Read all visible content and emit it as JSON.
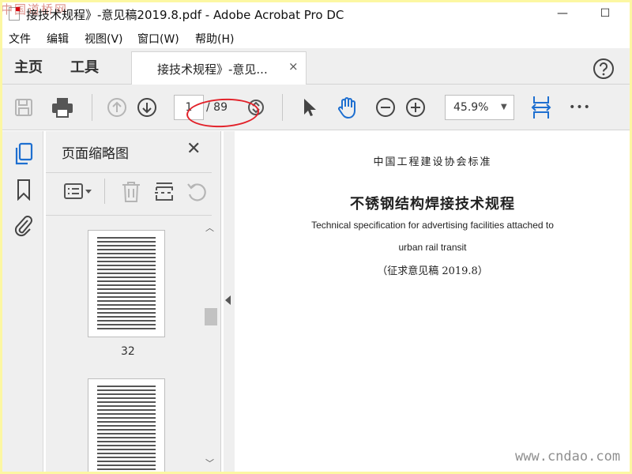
{
  "window": {
    "title": "接技术规程》-意见稿2019.8.pdf - Adobe Acrobat Pro DC",
    "watermark_top": "中国道桥网",
    "minimize": "—",
    "maximize": "☐"
  },
  "menu": [
    "文件",
    "编辑",
    "视图(V)",
    "窗口(W)",
    "帮助(H)"
  ],
  "tabs": {
    "home": "主页",
    "tools": "工具",
    "document": "接技术规程》-意见...",
    "close": "×"
  },
  "toolbar": {
    "page_current": "1",
    "page_total": "/ 89",
    "zoom": "45.9%",
    "more": "•••"
  },
  "thumbnails": {
    "title": "页面缩略图",
    "close": "✕",
    "visible_page_number": "32"
  },
  "document": {
    "org": "中国工程建设协会标准",
    "title": "不锈钢结构焊接技术规程",
    "english_line1": "Technical specification for advertising facilities attached to",
    "english_line2": "urban rail transit",
    "subtitle": "（征求意见稿 2019.8）"
  },
  "watermark": "www.cndao.com",
  "colors": {
    "accent_blue": "#1e6fd0",
    "annotation_red": "#e2222a",
    "toolbar_bg": "#efefef",
    "frame_yellow": "#fcf7a2"
  }
}
